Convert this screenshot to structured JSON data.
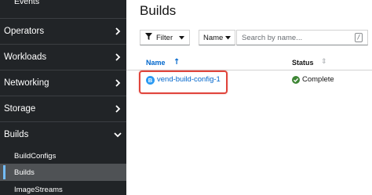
{
  "sidebar": {
    "partial_item": "Events",
    "sections": [
      {
        "label": "Operators",
        "state": "collapsed"
      },
      {
        "label": "Workloads",
        "state": "collapsed"
      },
      {
        "label": "Networking",
        "state": "collapsed"
      },
      {
        "label": "Storage",
        "state": "collapsed"
      },
      {
        "label": "Builds",
        "state": "expanded"
      }
    ],
    "builds_items": [
      {
        "label": "BuildConfigs"
      },
      {
        "label": "Builds",
        "active": true
      },
      {
        "label": "ImageStreams"
      }
    ]
  },
  "page": {
    "title": "Builds"
  },
  "toolbar": {
    "filter_label": "Filter",
    "filter_type": "Name",
    "search_placeholder": "Search by name...",
    "shortcut_key": "/"
  },
  "table": {
    "columns": [
      "Name",
      "Status"
    ],
    "rows": [
      {
        "badge": "B",
        "name": "vend-build-config-1",
        "status": "Complete"
      }
    ]
  },
  "colors": {
    "sidebar_bg": "#212427",
    "link": "#0066cc",
    "success": "#3e8635",
    "highlight": "#e0443b",
    "badge": "#2b9af3"
  }
}
